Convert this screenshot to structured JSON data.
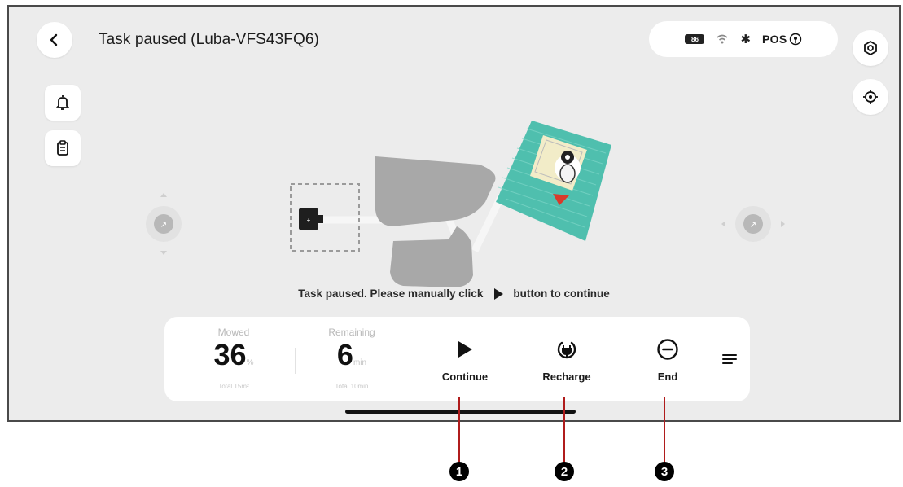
{
  "header": {
    "title": "Task paused (Luba-VFS43FQ6)",
    "back_icon": "chevron-left-icon",
    "settings_icon": "gear-icon"
  },
  "status_bar": {
    "battery_label": "86",
    "pos_label": "POS"
  },
  "left_tools": [
    {
      "icon": "bell-icon"
    },
    {
      "icon": "clipboard-icon"
    }
  ],
  "right_tools": [
    {
      "icon": "locate-icon"
    }
  ],
  "map": {
    "mower_marker": "mower-icon"
  },
  "hint": {
    "before": "Task paused. Please manually click",
    "after": "button to continue"
  },
  "panel": {
    "mowed": {
      "label": "Mowed",
      "value": "36",
      "unit": "%",
      "sub": "Total 15m²"
    },
    "remaining": {
      "label": "Remaining",
      "value": "6",
      "unit": "min",
      "sub": "Total 10min"
    },
    "actions": [
      {
        "label": "Continue",
        "icon": "play-icon"
      },
      {
        "label": "Recharge",
        "icon": "charge-icon"
      },
      {
        "label": "End",
        "icon": "stop-circle-icon"
      }
    ],
    "more_icon": "menu-icon"
  },
  "callouts": [
    "1",
    "2",
    "3"
  ],
  "colors": {
    "zone_active": "#4fbfae",
    "zone_inactive": "#a8a8a8",
    "callout_line": "#b01c1c",
    "direction_marker": "#d93a2b"
  }
}
